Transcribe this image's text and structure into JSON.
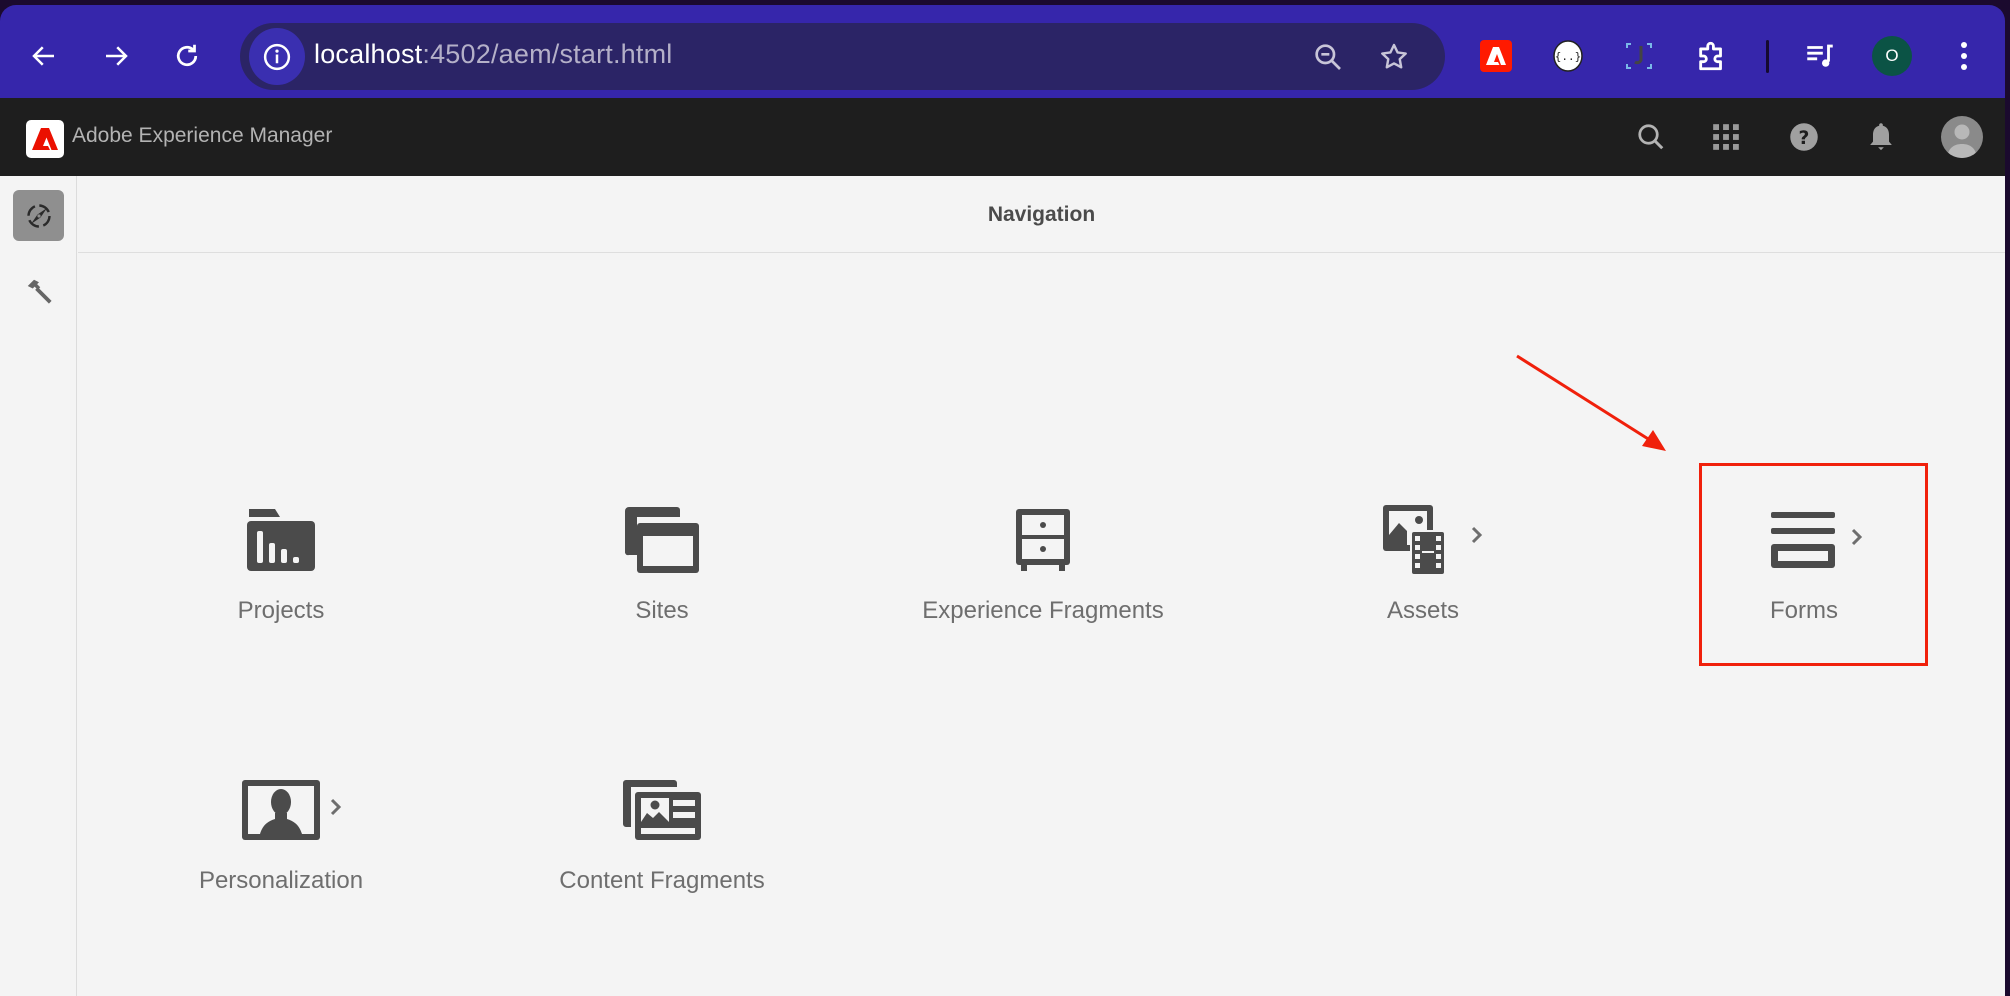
{
  "browser": {
    "url_host": "localhost",
    "url_rest": ":4502/aem/start.html",
    "nav_buttons": [
      "back",
      "forward",
      "reload"
    ],
    "pill_icons": [
      "zoom-out-icon",
      "bookmark-star-icon"
    ],
    "extensions": [
      "adobe-extension-icon",
      "json-formatter-extension-icon",
      "bracket-extension-icon",
      "extensions-puzzle-icon",
      "media-controls-icon"
    ],
    "profile_initial": "O",
    "colors": {
      "chrome": "#3626ab",
      "pill": "#2b2466",
      "profile": "#0b5345"
    }
  },
  "header": {
    "title": "Adobe Experience Manager",
    "icons": [
      "search-icon",
      "apps-grid-icon",
      "help-icon",
      "notifications-bell-icon",
      "user-avatar"
    ],
    "colors": {
      "background": "#1e1e1e",
      "logo_red": "#eb1000"
    }
  },
  "rail": {
    "items": [
      {
        "name": "navigation",
        "icon": "compass-icon",
        "active": true
      },
      {
        "name": "tools",
        "icon": "hammer-icon",
        "active": false
      }
    ]
  },
  "navigation": {
    "title": "Navigation",
    "tiles": [
      {
        "label": "Projects",
        "icon": "projects-folder-icon",
        "has_children": false
      },
      {
        "label": "Sites",
        "icon": "sites-windows-icon",
        "has_children": false
      },
      {
        "label": "Experience Fragments",
        "icon": "experience-fragments-cabinet-icon",
        "has_children": false
      },
      {
        "label": "Assets",
        "icon": "assets-image-film-icon",
        "has_children": true
      },
      {
        "label": "Forms",
        "icon": "forms-icon",
        "has_children": true,
        "highlighted": true
      },
      {
        "label": "Personalization",
        "icon": "personalization-person-icon",
        "has_children": true
      },
      {
        "label": "Content Fragments",
        "icon": "content-fragments-card-icon",
        "has_children": false
      }
    ]
  },
  "annotation": {
    "highlight_color": "#f0200b",
    "target": "Forms"
  }
}
